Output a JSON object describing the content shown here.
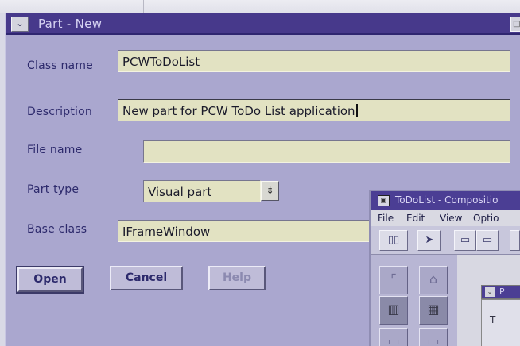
{
  "dialog": {
    "title": "Part - New",
    "sysmenu_glyph": "⌄",
    "maxbox_glyph": "□",
    "fields": {
      "class_name": {
        "label": "Class name",
        "value": "PCWToDoList"
      },
      "description": {
        "label": "Description",
        "value": "New part for PCW ToDo List application"
      },
      "file_name": {
        "label": "File name",
        "value": ""
      },
      "part_type": {
        "label": "Part type",
        "value": "Visual part",
        "dropdown_glyph": "⇟"
      },
      "base_class": {
        "label": "Base class",
        "value": "IFrameWindow"
      }
    },
    "buttons": {
      "open": "Open",
      "cancel": "Cancel",
      "help": "Help"
    }
  },
  "composition_window": {
    "title": "ToDoList - Compositio",
    "menu": {
      "file": "File",
      "edit": "Edit",
      "view": "View",
      "options": "Optio"
    },
    "subwindow": {
      "title_char": "P",
      "body_char": "T"
    }
  },
  "colors": {
    "dialog_bg": "#aaa7cf",
    "titlebar": "#47398b",
    "field_bg": "#e2e2c2",
    "label_text": "#2d2a6c"
  }
}
